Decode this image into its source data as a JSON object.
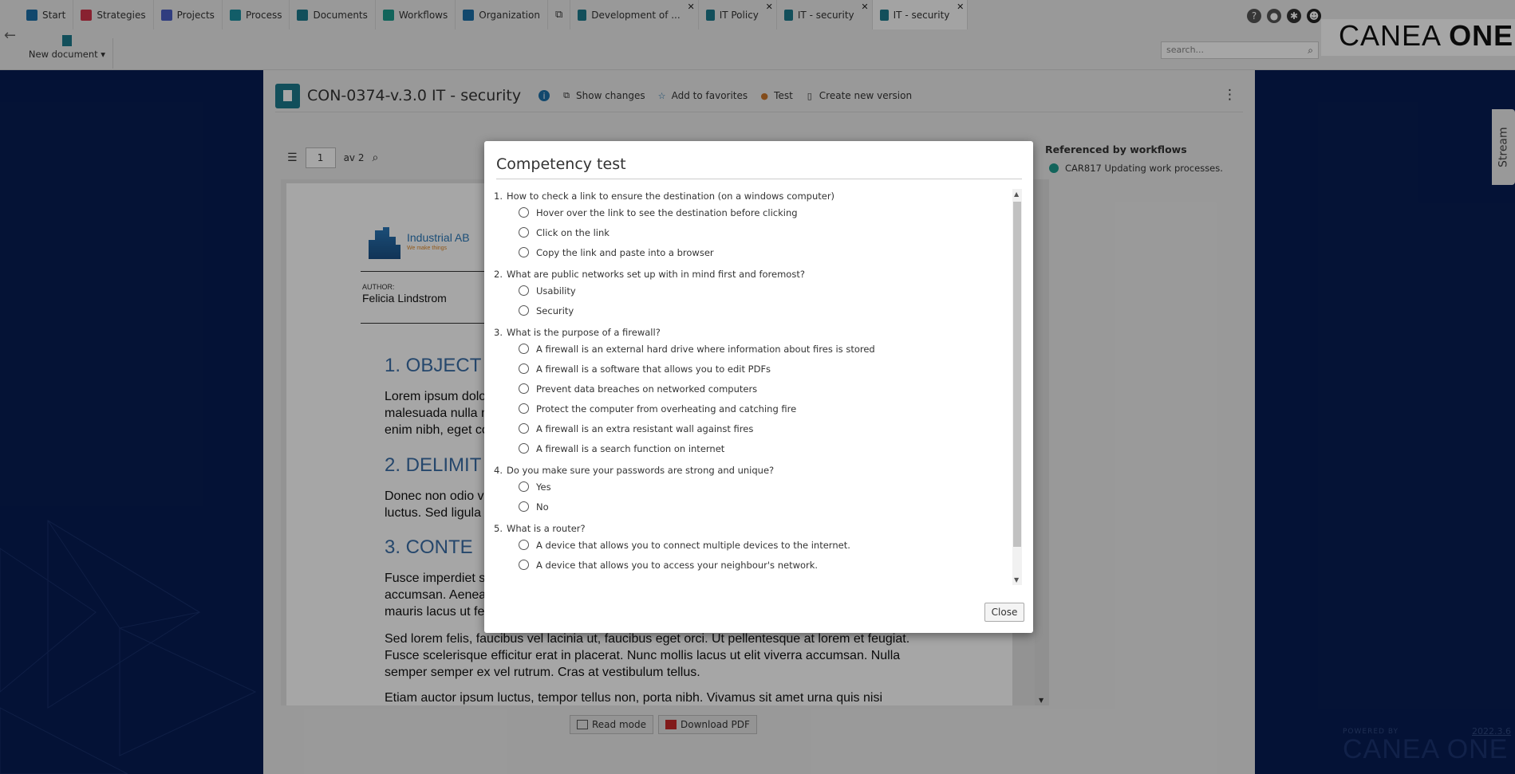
{
  "nav": {
    "tabs": [
      {
        "label": "Start",
        "icon": "home-icon",
        "color": "#1c6fa8"
      },
      {
        "label": "Strategies",
        "icon": "strategies-icon",
        "color": "#d2334a"
      },
      {
        "label": "Projects",
        "icon": "projects-icon",
        "color": "#4b5fc4"
      },
      {
        "label": "Process",
        "icon": "process-icon",
        "color": "#1c8fa0"
      },
      {
        "label": "Documents",
        "icon": "documents-icon",
        "color": "#1c7a8c"
      },
      {
        "label": "Workflows",
        "icon": "workflows-icon",
        "color": "#1c9a8c"
      },
      {
        "label": "Organization",
        "icon": "organization-icon",
        "color": "#1c6fa8"
      }
    ],
    "doc_tabs": [
      {
        "label": "Development of ...",
        "icon": "development-icon"
      },
      {
        "label": "IT Policy",
        "icon": "document-icon"
      },
      {
        "label": "IT - security",
        "icon": "document-icon"
      },
      {
        "label": "IT - security",
        "icon": "document-icon"
      }
    ],
    "new_document": "New document",
    "search_placeholder": "search..."
  },
  "brand": {
    "light": "CANEA",
    "bold": "ONE"
  },
  "document": {
    "title": "CON-0374-v.3.0 IT - security",
    "actions": {
      "show_changes": "Show changes",
      "add_to_favorites": "Add to favorites",
      "test": "Test",
      "create_new_version": "Create new version"
    },
    "page_number": "1",
    "page_of": "av 2",
    "logo_name": "Industrial AB",
    "logo_tagline": "We make things",
    "author_label": "AUTHOR:",
    "author": "Felicia Lindstrom",
    "headings": [
      "1.   OBJECT",
      "2.   DELIMIT",
      "3.   CONTE"
    ],
    "p1": "Lorem ipsum dolo\nmalesuada nulla n\nenim nibh, eget co",
    "p2": "Donec non odio v\nluctus. Sed ligula",
    "p3": "Fusce imperdiet s\naccumsan. Aenea\nmauris lacus ut fe",
    "p4": "Sed lorem felis, faucibus vel lacinia ut, faucibus eget orci. Ut pellentesque at lorem et feugiat.\nFusce scelerisque efficitur erat in placerat. Nunc mollis lacus ut elit viverra accumsan. Nulla\nsemper semper ex vel rutrum. Cras at vestibulum tellus.",
    "p5": "Etiam auctor ipsum luctus, tempor tellus non, porta nibh. Vivamus sit amet urna quis nisi",
    "read_mode": "Read mode",
    "download_pdf": "Download PDF"
  },
  "referenced_by": {
    "heading": "Referenced by workflows",
    "items": [
      "CAR817 Updating work processes."
    ]
  },
  "stream_label": "Stream",
  "powered_by": "POWERED BY",
  "powered_brand": "CANEA ONE",
  "version": "2022.3.6",
  "modal": {
    "title": "Competency test",
    "close_label": "Close",
    "questions": [
      {
        "num": "1.",
        "text": "How to check a link to ensure the destination (on a windows computer)",
        "options": [
          "Hover over the link to see the destination before clicking",
          "Click on the link",
          "Copy the link and paste into a browser"
        ]
      },
      {
        "num": "2.",
        "text": "What are public networks set up with in mind first and foremost?",
        "options": [
          "Usability",
          "Security"
        ]
      },
      {
        "num": "3.",
        "text": "What is the purpose of a firewall?",
        "options": [
          "A firewall is an external hard drive where information about fires is stored",
          "A firewall is a software that allows you to edit PDFs",
          "Prevent data breaches on networked computers",
          "Protect the computer from overheating and catching fire",
          "A firewall is an extra resistant wall against fires",
          "A firewall is a search function on internet"
        ]
      },
      {
        "num": "4.",
        "text": "Do you make sure your passwords are strong and unique?",
        "options": [
          "Yes",
          "No"
        ]
      },
      {
        "num": "5.",
        "text": "What is a router?",
        "options": [
          "A device that allows you to connect multiple devices to the internet.",
          "A device that allows you to access your neighbour's network."
        ]
      }
    ]
  }
}
